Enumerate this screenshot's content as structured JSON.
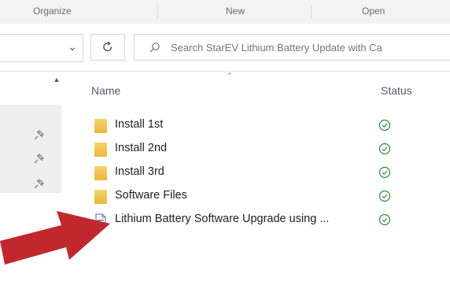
{
  "ribbon": {
    "groups": [
      "Organize",
      "New",
      "Open"
    ]
  },
  "nav": {
    "search_placeholder": "Search StarEV Lithium Battery Update with Ca"
  },
  "list": {
    "columns": {
      "name": "Name",
      "status": "Status"
    },
    "items": [
      {
        "name": "Install 1st",
        "type": "folder",
        "status": "synced"
      },
      {
        "name": "Install 2nd",
        "type": "folder",
        "status": "synced"
      },
      {
        "name": "Install 3rd",
        "type": "folder",
        "status": "synced"
      },
      {
        "name": "Software Files",
        "type": "folder",
        "status": "synced"
      },
      {
        "name": "Lithium Battery Software Upgrade using ...",
        "type": "document",
        "status": "synced"
      }
    ]
  },
  "icons": {
    "chevron": "chevron-down-icon",
    "refresh": "refresh-icon",
    "search": "search-icon",
    "pin": "pin-icon",
    "folder": "folder-icon",
    "document": "document-icon",
    "status": "check-circle-icon",
    "arrow": "red-pointer-arrow"
  },
  "colors": {
    "status_green": "#2e8b3a",
    "folder_yellow": "#e9b73b",
    "arrow_red": "#c1272d"
  }
}
